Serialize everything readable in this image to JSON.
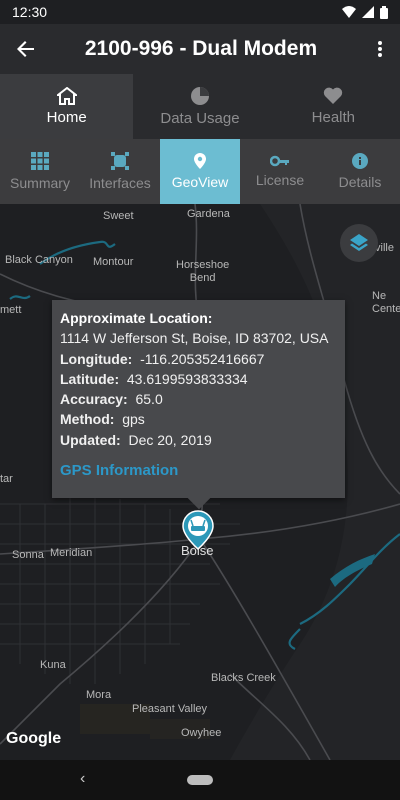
{
  "status_bar": {
    "time": "12:30"
  },
  "app_bar": {
    "title": "2100-996 - Dual Modem"
  },
  "primary_tabs": [
    {
      "label": "Home"
    },
    {
      "label": "Data Usage"
    },
    {
      "label": "Health"
    }
  ],
  "secondary_tabs": [
    {
      "label": "Summary"
    },
    {
      "label": "Interfaces"
    },
    {
      "label": "GeoView"
    },
    {
      "label": "License"
    },
    {
      "label": "Details"
    }
  ],
  "map": {
    "labels": {
      "sweet": "Sweet",
      "gardena": "Gardena",
      "black_canyon": "Black Canyon",
      "montour": "Montour",
      "horseshoe_bend": "Horseshoe\nBend",
      "emmett": "mett",
      "new_centerville": "Ne\nCente",
      "idaho_city": "ville",
      "star": "tar",
      "sonna": "Sonna",
      "meridian": "Meridian",
      "boise": "Boise",
      "kuna": "Kuna",
      "mora": "Mora",
      "blacks_creek": "Blacks Creek",
      "pleasant_valley": "Pleasant Valley",
      "owyhee": "Owyhee"
    },
    "google_logo": "Google"
  },
  "info_card": {
    "heading": "Approximate Location:",
    "address": "1114 W Jefferson St, Boise, ID 83702, USA",
    "longitude_label": "Longitude:",
    "longitude_value": "-116.205352416667",
    "latitude_label": "Latitude:",
    "latitude_value": "43.6199593833334",
    "accuracy_label": "Accuracy:",
    "accuracy_value": "65.0",
    "method_label": "Method:",
    "method_value": "gps",
    "updated_label": "Updated:",
    "updated_value": "Dec 20, 2019",
    "link": "GPS Information"
  },
  "colors": {
    "accent": "#6cbdd2",
    "link": "#2c98c8",
    "water": "#1c6a80"
  }
}
